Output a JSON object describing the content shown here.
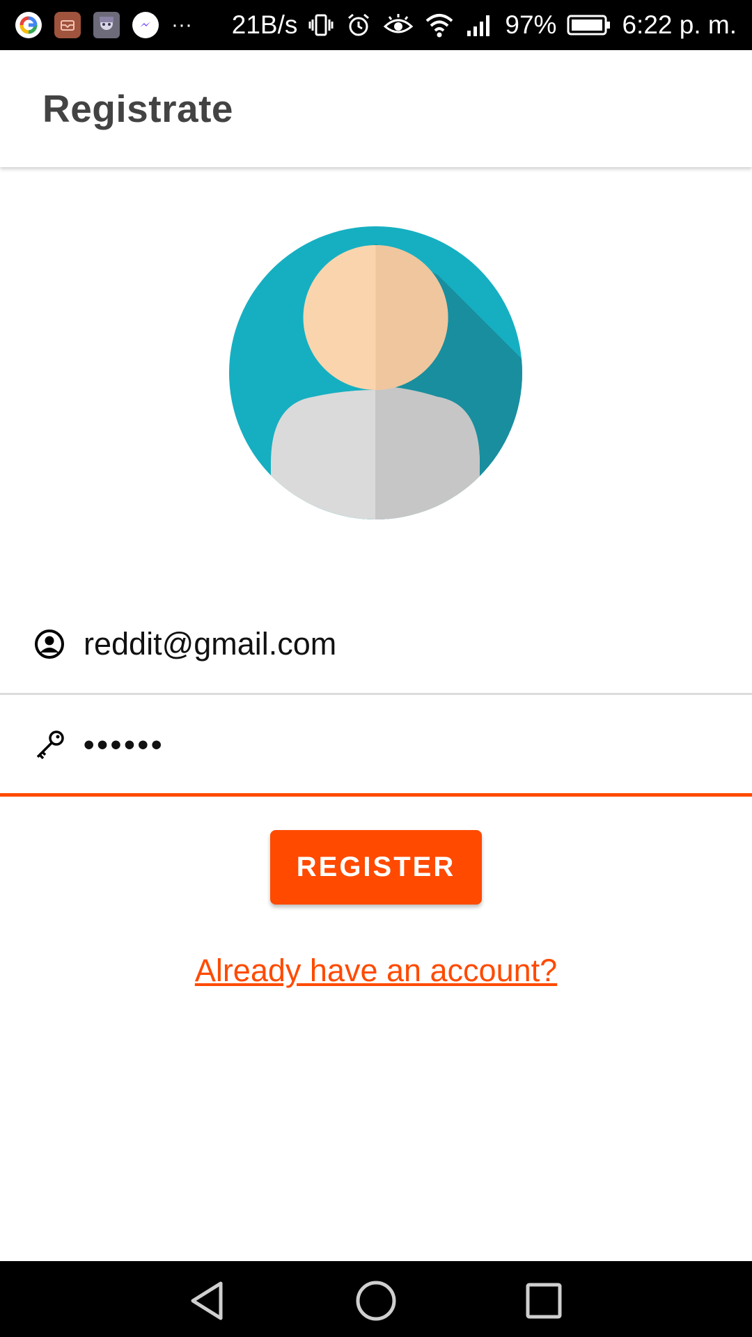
{
  "status_bar": {
    "network_speed": "21B/s",
    "battery": "97%",
    "time": "6:22 p. m.",
    "overflow": "···",
    "icons": [
      "google-icon",
      "mail-icon",
      "anime-avatar-icon",
      "messenger-icon",
      "vibrate-icon",
      "alarm-icon",
      "eye-icon",
      "wifi-icon",
      "signal-icon",
      "battery-icon"
    ]
  },
  "app_bar": {
    "title": "Registrate"
  },
  "form": {
    "email": {
      "value": "reddit@gmail.com",
      "icon": "account-circle-icon"
    },
    "password": {
      "value": "••••••",
      "icon": "key-icon"
    },
    "register_label": "REGISTER",
    "login_link": "Already have an account?"
  },
  "colors": {
    "accent": "#ff4a00",
    "avatar_bg": "#16afc1",
    "avatar_shadow": "#1a8b9a",
    "skin": "#fad4ad",
    "skin_shade": "#efc69d",
    "shirt": "#dadada",
    "shirt_shade": "#c6c6c6"
  },
  "nav_bar": {
    "icons": [
      "back-icon",
      "home-icon",
      "recents-icon"
    ]
  }
}
